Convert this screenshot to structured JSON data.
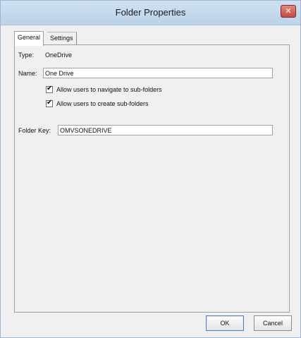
{
  "window": {
    "title": "Folder Properties",
    "close_symbol": "✕"
  },
  "tabs": [
    {
      "label": "General",
      "active": true
    },
    {
      "label": "Settings",
      "active": false
    }
  ],
  "general": {
    "type_label": "Type:",
    "type_value": "OneDrive",
    "name_label": "Name:",
    "name_value": "One Drive",
    "allow_navigate": {
      "label": "Allow users to navigate to sub-folders",
      "checked": true
    },
    "allow_create": {
      "label": "Allow users to create sub-folders",
      "checked": true
    },
    "folder_key_label": "Folder Key:",
    "folder_key_value": "OMVSONEDRIVE"
  },
  "buttons": {
    "ok": "OK",
    "cancel": "Cancel"
  },
  "icons": {
    "close": "close-icon",
    "checkmark": "checkmark-icon"
  },
  "colors": {
    "titlebar": "#c6dbef",
    "close_button": "#c85a4e",
    "dialog_background": "#f0f0f0"
  }
}
